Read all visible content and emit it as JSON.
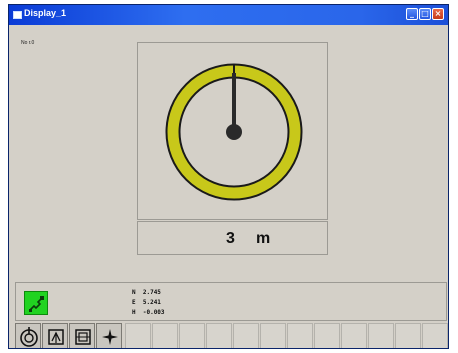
{
  "window": {
    "title": "Display_1"
  },
  "corner_label": "No r.0",
  "gauge": {
    "value": "3",
    "unit": "m",
    "ring_color": "#c8c81a"
  },
  "coordinates": [
    {
      "axis": "N",
      "value": "2.745"
    },
    {
      "axis": "E",
      "value": "5.241"
    },
    {
      "axis": "H",
      "value": "-0.003"
    }
  ],
  "status_icon": "satellite-icon",
  "toolbar": {
    "buttons": [
      "target-icon",
      "station-setup-icon",
      "measure-icon",
      "star-icon"
    ],
    "empty_slot_count": 12
  }
}
